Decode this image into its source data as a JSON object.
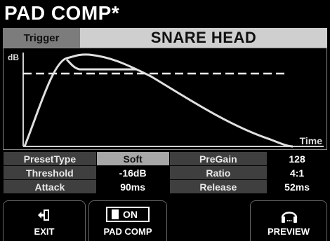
{
  "header": {
    "title": "PAD COMP*"
  },
  "trigger": {
    "label": "Trigger",
    "name": "SNARE HEAD"
  },
  "graph": {
    "y_axis_label": "dB",
    "x_axis_label": "Time"
  },
  "params": {
    "row1": {
      "label1": "PresetType",
      "value1": "Soft",
      "label2": "PreGain",
      "value2": "128"
    },
    "row2": {
      "label1": "Threshold",
      "value1": "-16dB",
      "label2": "Ratio",
      "value2": "4:1"
    },
    "row3": {
      "label1": "Attack",
      "value1": "90ms",
      "label2": "Release",
      "value2": "52ms"
    }
  },
  "softkeys": {
    "exit": "EXIT",
    "pad_comp": "PAD COMP",
    "pad_comp_state": "ON",
    "preview": "PREVIEW"
  },
  "colors": {
    "background": "#000000",
    "selected_cell": "#a7a7a7",
    "label_cell": "#3f3f3f",
    "curve": "#d8d8d8"
  },
  "icons": {
    "exit": "exit-arrow-icon",
    "preview": "headphones-icon"
  }
}
